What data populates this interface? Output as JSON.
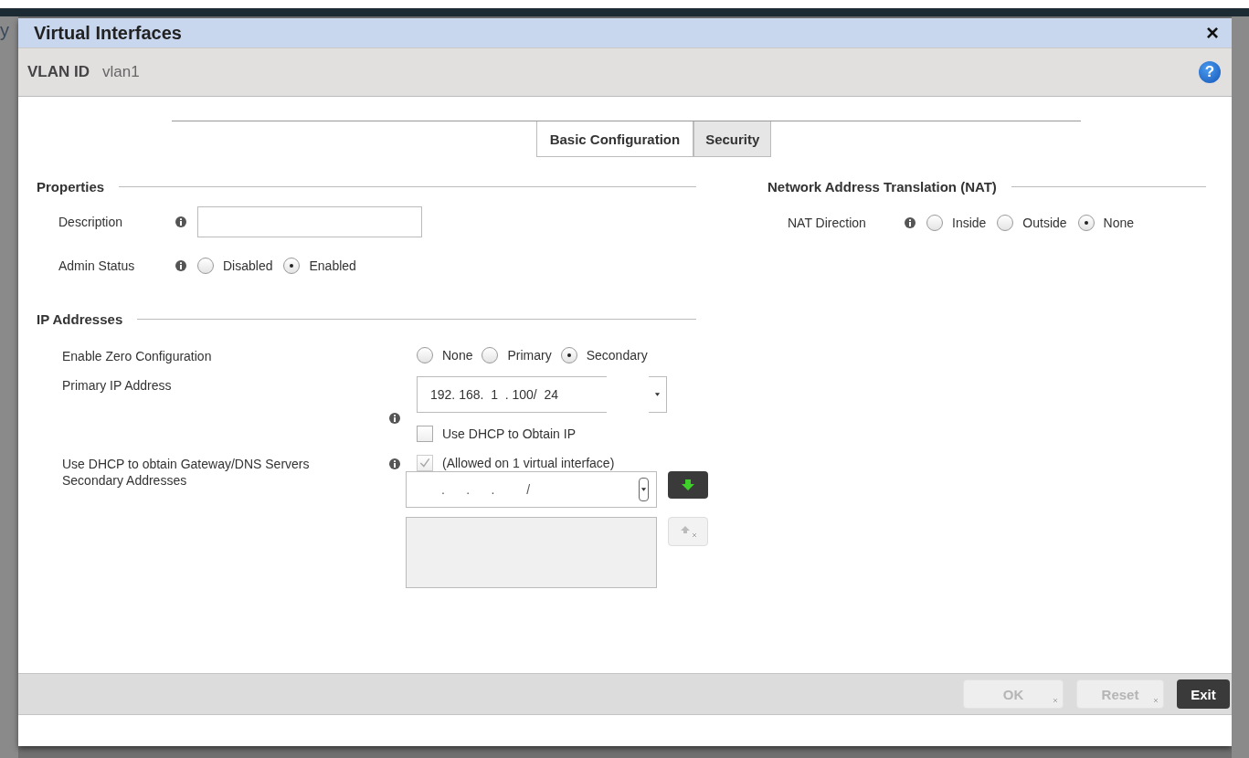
{
  "background_text": "y",
  "window": {
    "title": "Virtual Interfaces",
    "close": "×"
  },
  "header": {
    "label": "VLAN ID",
    "value": "vlan1",
    "help": "?"
  },
  "tabs": [
    {
      "label": "Basic Configuration",
      "selected": true
    },
    {
      "label": "Security",
      "selected": false
    }
  ],
  "properties": {
    "title": "Properties",
    "description": {
      "label": "Description"
    },
    "admin_status": {
      "label": "Admin Status",
      "options": [
        {
          "label": "Disabled",
          "selected": false
        },
        {
          "label": "Enabled",
          "selected": true
        }
      ]
    }
  },
  "ip_addresses": {
    "title": "IP Addresses",
    "zero_config": {
      "label": "Enable Zero Configuration",
      "options": [
        {
          "label": "None",
          "selected": false
        },
        {
          "label": "Primary",
          "selected": false
        },
        {
          "label": "Secondary",
          "selected": true
        }
      ]
    },
    "primary_ip": {
      "label": "Primary IP Address",
      "value": "192. 168.  1  . 100/  24"
    },
    "use_dhcp": {
      "label": "Use DHCP to Obtain IP",
      "checked": false
    },
    "dhcp_gateway": {
      "label": "Use DHCP to obtain Gateway/DNS Servers",
      "checked": true,
      "disabled": true,
      "note": "(Allowed on 1 virtual interface)"
    },
    "secondary": {
      "label": "Secondary Addresses",
      "mask": ".      .      .         /"
    }
  },
  "nat": {
    "title": "Network Address Translation (NAT)",
    "direction": {
      "label": "NAT Direction",
      "options": [
        {
          "label": "Inside",
          "selected": false
        },
        {
          "label": "Outside",
          "selected": false
        },
        {
          "label": "None",
          "selected": true
        }
      ]
    }
  },
  "buttons": [
    {
      "label": "OK",
      "disabled": true
    },
    {
      "label": "Reset",
      "disabled": true
    },
    {
      "label": "Exit",
      "disabled": false
    }
  ]
}
